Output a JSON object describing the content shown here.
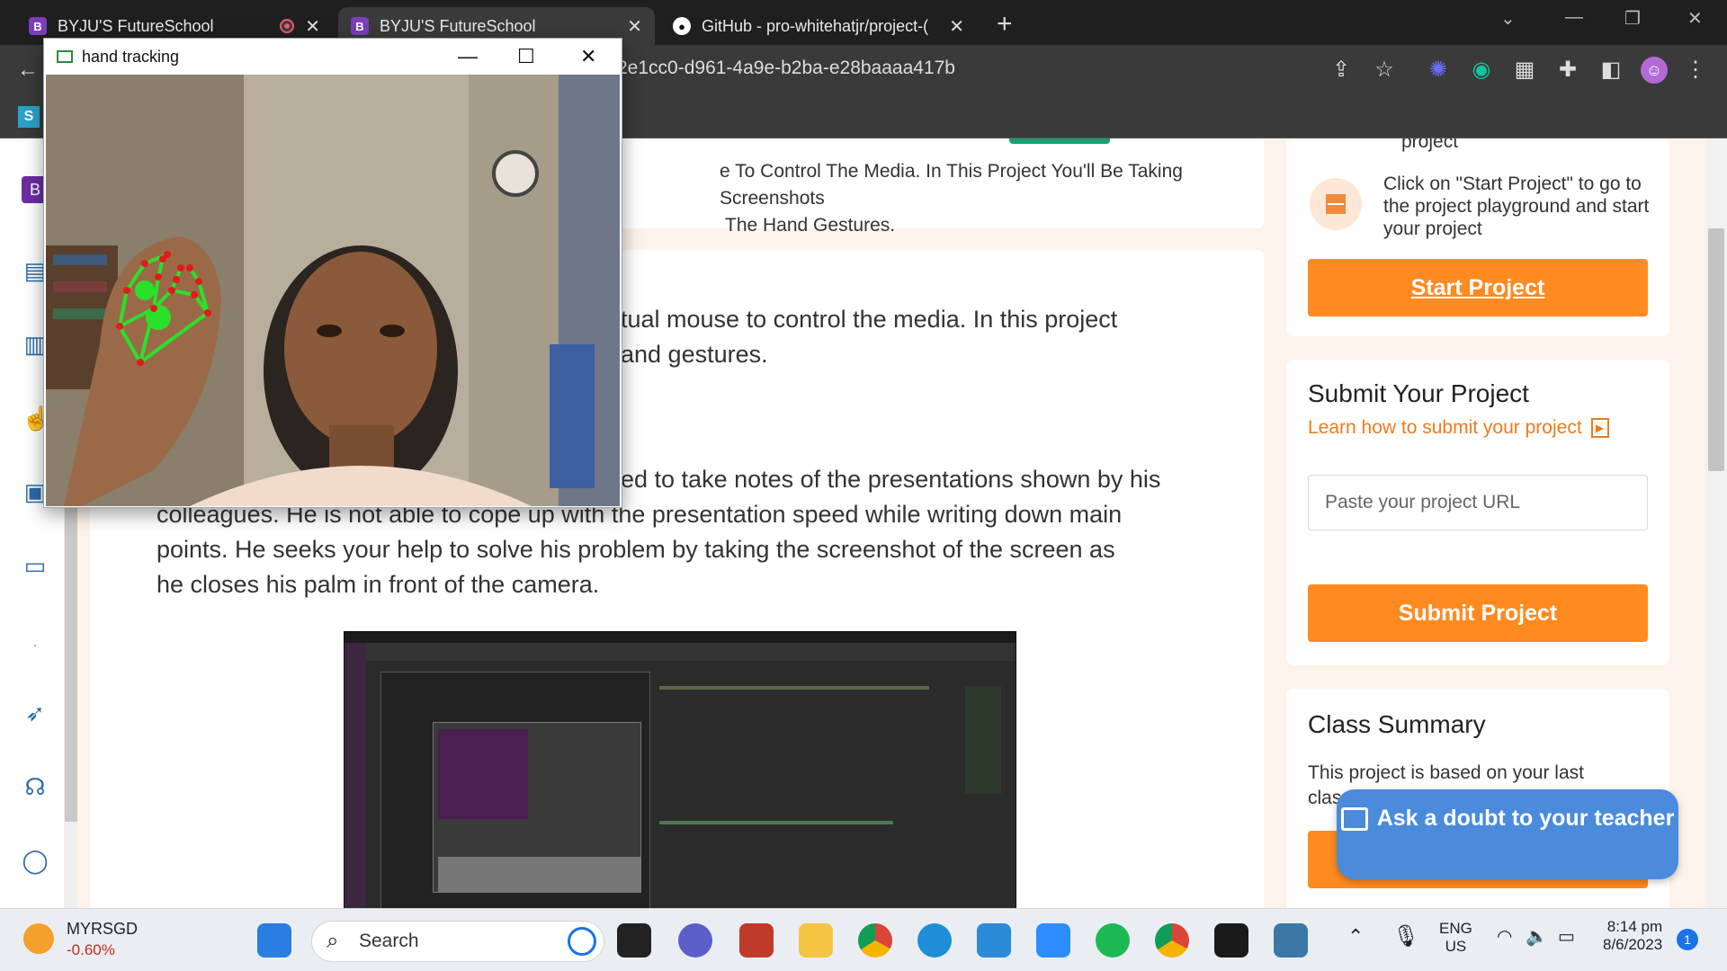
{
  "browser": {
    "tabs": [
      {
        "title": "BYJU'S FutureSchool",
        "favicon": "byjus-icon",
        "recording": true
      },
      {
        "title": "BYJU'S FutureSchool",
        "favicon": "byjus-icon",
        "active": true
      },
      {
        "title": "GitHub - pro-whitehatjr/project-(",
        "favicon": "github-icon"
      }
    ],
    "url": "2e1cc0-d961-4a9e-b2ba-e28baaaa417b"
  },
  "camera_window": {
    "title": "hand tracking"
  },
  "page": {
    "intro_line1": "e To Control The Media. In This Project You'll Be Taking Screenshots",
    "intro_line2": "The Hand Gestures.",
    "desc_line1": "tual mouse to control the media. In this project",
    "desc_line2": "and gestures.",
    "story_line1": "ed to take notes of the presentations shown by his",
    "story_line2": "colleagues. He is not able to cope up with the presentation speed while writing down main",
    "story_line3": "points. He seeks your help to solve his problem by taking the screenshot of the screen as",
    "story_line4": "he closes his palm in front of the camera."
  },
  "sidebar": {
    "project_tail": "project",
    "start_hint": "Click on \"Start Project\" to go to the project playground and start your project",
    "start_button": "Start Project",
    "submit_title": "Submit Your Project",
    "submit_link": "Learn how to submit your project",
    "url_placeholder": "Paste your project URL",
    "submit_button": "Submit Project",
    "summary_title": "Class Summary",
    "summary_text": "This project is based on your last",
    "summary_text2": "clas"
  },
  "doubt_button": "Ask a doubt to your teacher",
  "taskbar": {
    "stock_symbol": "MYRSGD",
    "stock_change": "-0.60%",
    "search_placeholder": "Search",
    "lang_line1": "ENG",
    "lang_line2": "US",
    "time": "8:14 pm",
    "date": "8/6/2023",
    "notification_count": "1"
  },
  "colors": {
    "accent_orange": "#ff8a1f",
    "doubt_blue": "#4a8bdc",
    "link_orange": "#f07a1a"
  }
}
